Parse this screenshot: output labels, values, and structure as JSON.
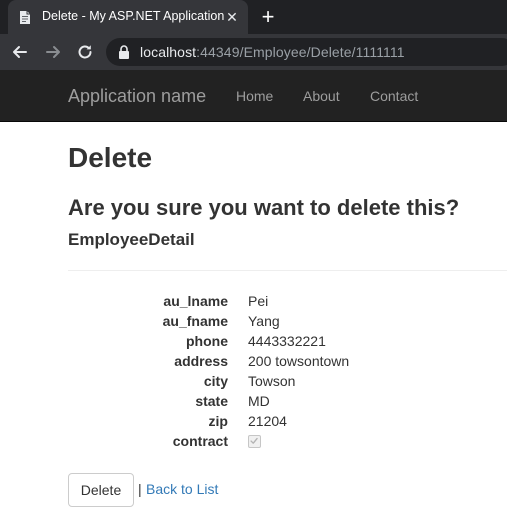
{
  "browser": {
    "tab_title": "Delete - My ASP.NET Application",
    "url_host": "localhost",
    "url_path": ":44349/Employee/Delete/1111111",
    "icons": [
      "page-icon",
      "close-icon",
      "plus-icon",
      "back-arrow-icon",
      "forward-arrow-icon",
      "reload-icon",
      "lock-icon"
    ]
  },
  "navbar": {
    "brand": "Application name",
    "links": [
      "Home",
      "About",
      "Contact"
    ]
  },
  "page": {
    "title": "Delete",
    "question": "Are you sure you want to delete this?",
    "subtitle": "EmployeeDetail"
  },
  "details": [
    {
      "label": "au_lname",
      "value": "Pei"
    },
    {
      "label": "au_fname",
      "value": "Yang"
    },
    {
      "label": "phone",
      "value": "4443332221"
    },
    {
      "label": "address",
      "value": "200 towsontown"
    },
    {
      "label": "city",
      "value": "Towson"
    },
    {
      "label": "state",
      "value": "MD"
    },
    {
      "label": "zip",
      "value": "21204"
    },
    {
      "label": "contract",
      "checked": true
    }
  ],
  "actions": {
    "delete_label": "Delete",
    "separator": "|",
    "back_label": "Back to List"
  },
  "colors": {
    "navbar_bg": "#222222",
    "navbar_text": "#9d9d9d",
    "link": "#337ab7",
    "text": "#333333"
  }
}
